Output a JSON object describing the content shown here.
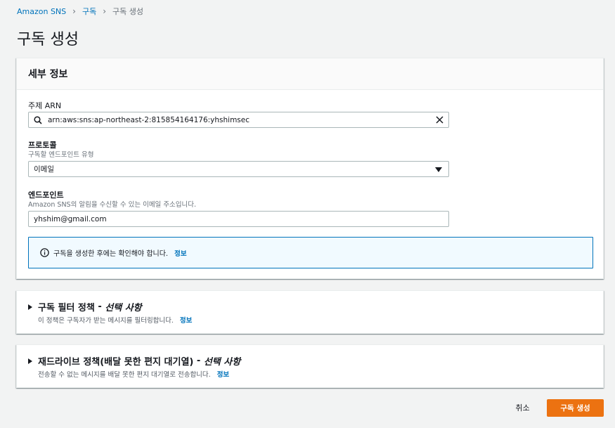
{
  "breadcrumb": {
    "items": [
      "Amazon SNS",
      "구독",
      "구독 생성"
    ]
  },
  "page_title": "구독 생성",
  "details": {
    "header": "세부 정보",
    "topic_arn": {
      "label": "주제 ARN",
      "value": "arn:aws:sns:ap-northeast-2:815854164176:yhshimsec"
    },
    "protocol": {
      "label": "프로토콜",
      "description": "구독할 엔드포인트 유형",
      "value": "이메일"
    },
    "endpoint": {
      "label": "엔드포인트",
      "description": "Amazon SNS의 알림을 수신할 수 있는 이메일 주소입니다.",
      "value": "yhshim@gmail.com"
    },
    "info_box": {
      "text": "구독을 생성한 후에는 확인해야 합니다.",
      "link": "정보"
    }
  },
  "filter_policy": {
    "title": "구독 필터 정책",
    "separator": " - ",
    "optional": "선택 사항",
    "description": "이 정책은 구독자가 받는 메시지를 필터링합니다.",
    "link": "정보"
  },
  "redrive_policy": {
    "title": "재드라이브 정책(배달 못한 편지 대기열)",
    "separator": " - ",
    "optional": "선택 사항",
    "description": "전송할 수 없는 메시지를 배달 못한 편지 대기열로 전송합니다.",
    "link": "정보"
  },
  "actions": {
    "cancel": "취소",
    "create": "구독 생성"
  },
  "colors": {
    "accent": "#ec7211",
    "link": "#0073bb",
    "info_bg": "#f1faff"
  },
  "icons": [
    "chevron-right-icon",
    "search-icon",
    "close-icon",
    "caret-down-icon",
    "info-icon",
    "triangle-right-icon"
  ]
}
